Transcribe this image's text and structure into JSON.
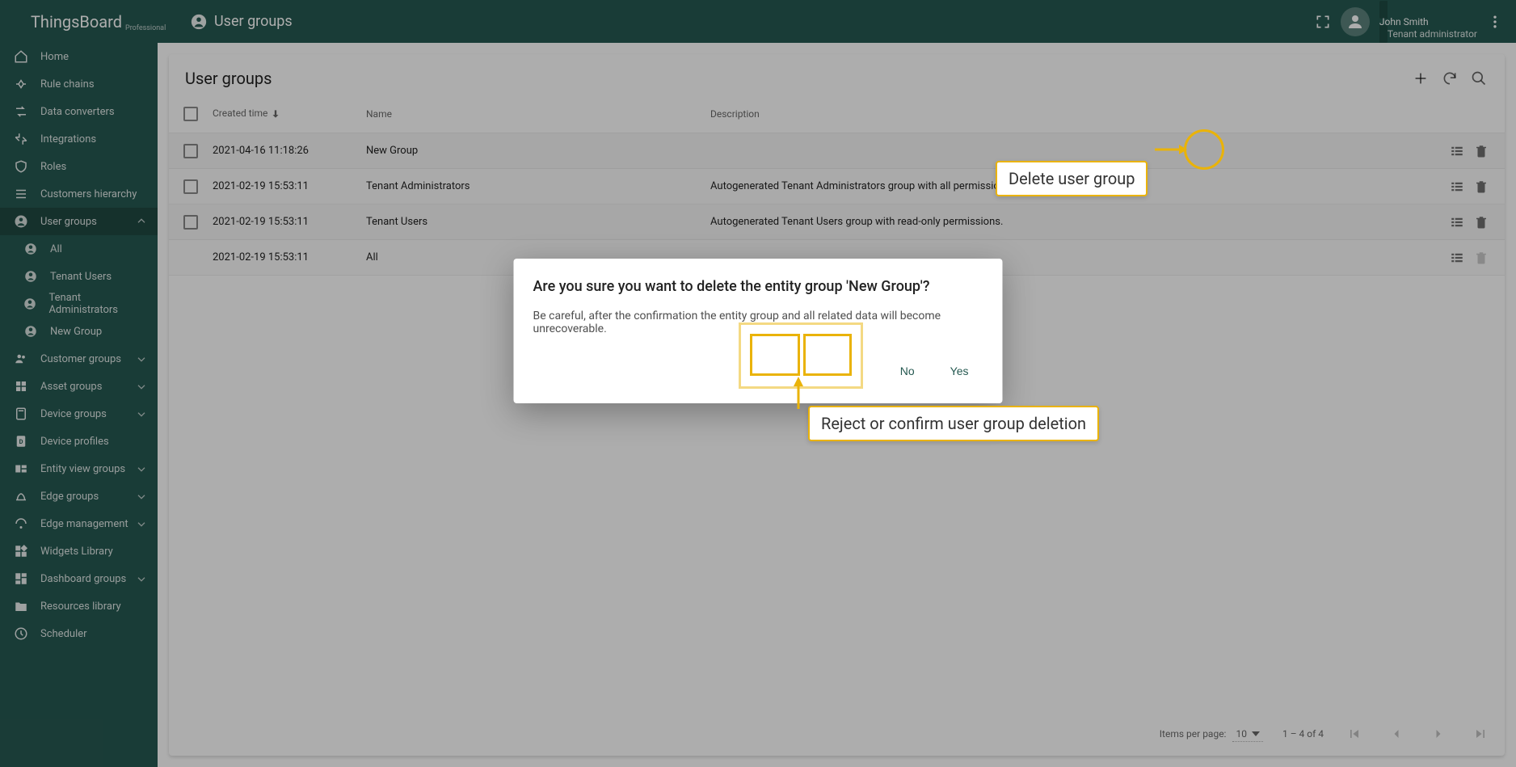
{
  "brand": {
    "name": "ThingsBoard",
    "edition": "Professional"
  },
  "header": {
    "title": "User groups",
    "user_name": "John Smith",
    "user_role": "Tenant administrator"
  },
  "sidebar": [
    {
      "label": "Home",
      "icon": "home"
    },
    {
      "label": "Rule chains",
      "icon": "rule"
    },
    {
      "label": "Data converters",
      "icon": "convert"
    },
    {
      "label": "Integrations",
      "icon": "integration"
    },
    {
      "label": "Roles",
      "icon": "shield"
    },
    {
      "label": "Customers hierarchy",
      "icon": "hierarchy"
    },
    {
      "label": "User groups",
      "icon": "user",
      "selected": true,
      "expanded": true,
      "children": [
        {
          "label": "All"
        },
        {
          "label": "Tenant Users"
        },
        {
          "label": "Tenant Administrators"
        },
        {
          "label": "New Group"
        }
      ]
    },
    {
      "label": "Customer groups",
      "icon": "customers",
      "expandable": true
    },
    {
      "label": "Asset groups",
      "icon": "assets",
      "expandable": true
    },
    {
      "label": "Device groups",
      "icon": "devices",
      "expandable": true
    },
    {
      "label": "Device profiles",
      "icon": "profile"
    },
    {
      "label": "Entity view groups",
      "icon": "views",
      "expandable": true
    },
    {
      "label": "Edge groups",
      "icon": "edge",
      "expandable": true
    },
    {
      "label": "Edge management",
      "icon": "edgemgmt",
      "expandable": true
    },
    {
      "label": "Widgets Library",
      "icon": "widgets"
    },
    {
      "label": "Dashboard groups",
      "icon": "dashboards",
      "expandable": true
    },
    {
      "label": "Resources library",
      "icon": "folder"
    },
    {
      "label": "Scheduler",
      "icon": "schedule"
    }
  ],
  "list": {
    "title": "User groups",
    "columns": {
      "time": "Created time",
      "name": "Name",
      "desc": "Description"
    },
    "rows": [
      {
        "time": "2021-04-16 11:18:26",
        "name": "New Group",
        "desc": "",
        "can_delete": true
      },
      {
        "time": "2021-02-19 15:53:11",
        "name": "Tenant Administrators",
        "desc": "Autogenerated Tenant Administrators group with all permissions.",
        "can_delete": true
      },
      {
        "time": "2021-02-19 15:53:11",
        "name": "Tenant Users",
        "desc": "Autogenerated Tenant Users group with read-only permissions.",
        "can_delete": true
      },
      {
        "time": "2021-02-19 15:53:11",
        "name": "All",
        "desc": "",
        "can_delete": false
      }
    ]
  },
  "pager": {
    "items_label": "Items per page:",
    "page_size": "10",
    "range": "1 – 4 of 4"
  },
  "dialog": {
    "title": "Are you sure you want to delete the entity group 'New Group'?",
    "body": "Be careful, after the confirmation the entity group and all related data will become unrecoverable.",
    "no": "No",
    "yes": "Yes"
  },
  "annotations": {
    "delete": "Delete user group",
    "confirm": "Reject or confirm user group deletion"
  }
}
